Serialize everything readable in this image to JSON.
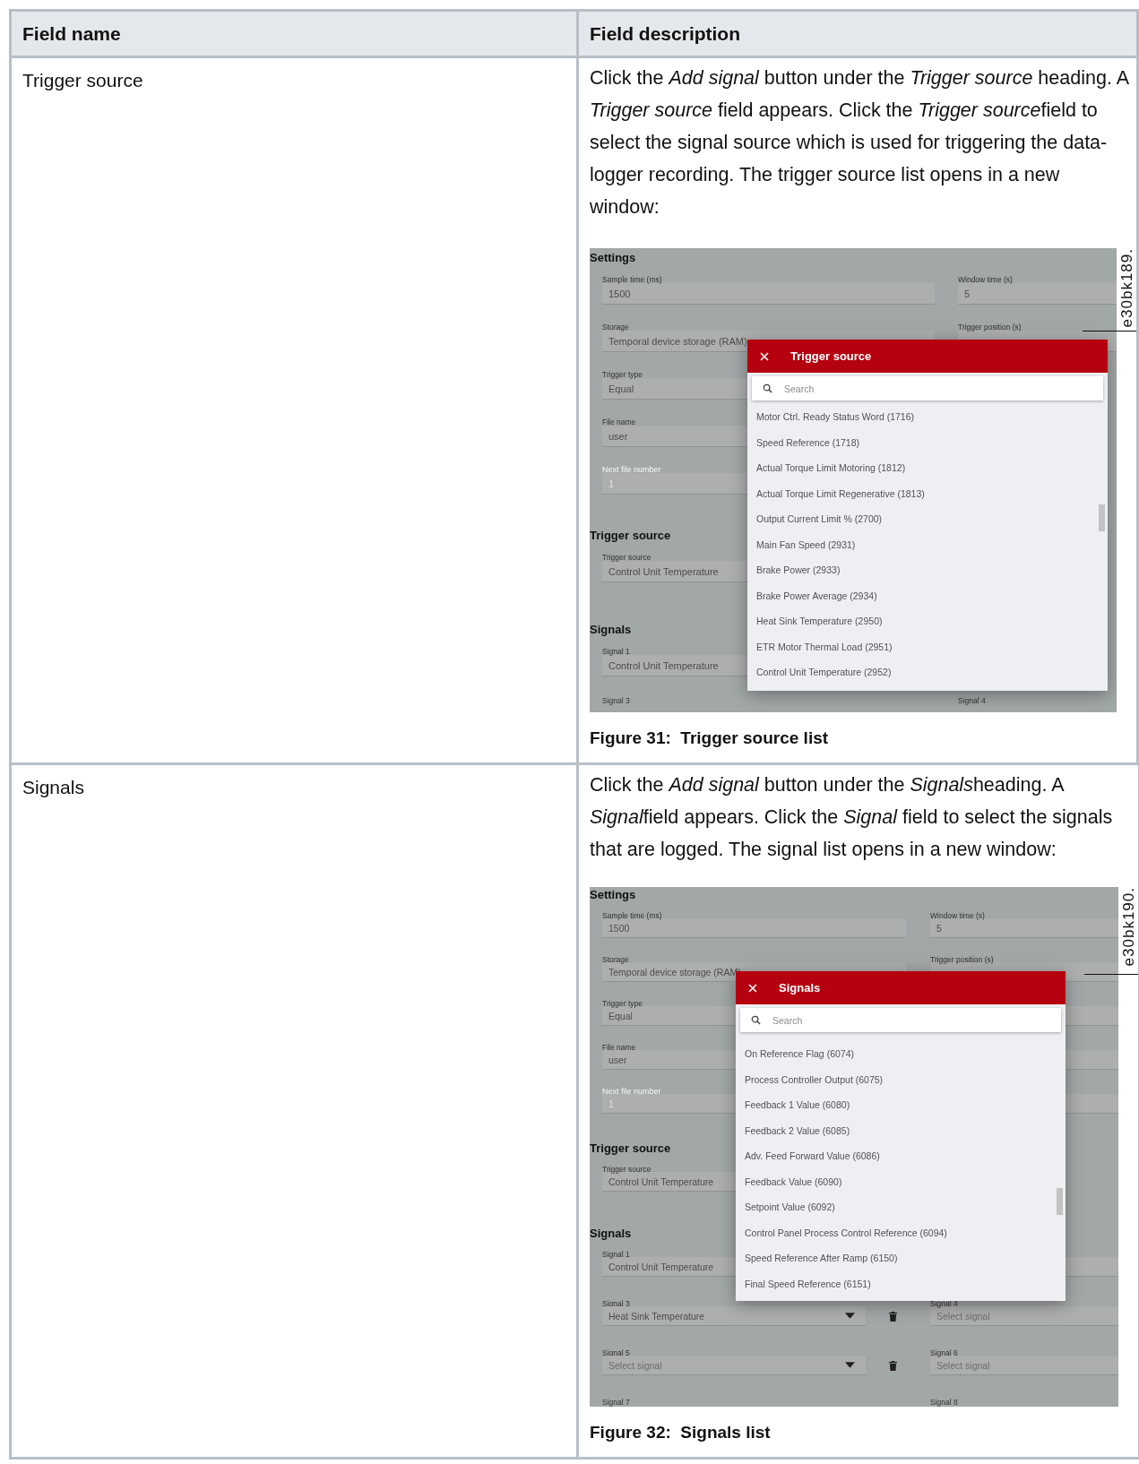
{
  "table": {
    "columns": [
      "Field name",
      "Field description"
    ],
    "rows": [
      {
        "field_name": "Trigger source",
        "description": [
          {
            "text": "Click the ",
            "italic": false
          },
          {
            "text": "Add signal",
            "italic": true
          },
          {
            "text": " button under the ",
            "italic": false
          },
          {
            "text": "Trigger source",
            "italic": true
          },
          {
            "text": " heading. A ",
            "italic": false
          },
          {
            "text": "Trigger source",
            "italic": true
          },
          {
            "text": " field appears. Click the ",
            "italic": false
          },
          {
            "text": "Trigger source",
            "italic": true
          },
          {
            "text": "field to select the signal source which is used for triggering the data-logger recording. The trigger source list opens in a new window:",
            "italic": false
          }
        ],
        "figure": {
          "id_label": "e30bk189.",
          "sections": [
            {
              "heading": "Settings",
              "rows": [
                [
                  {
                    "kind": "field",
                    "label": "Sample time (ms)",
                    "value": "1500",
                    "disabled": false
                  },
                  {
                    "kind": "field",
                    "label": "Window time (s)",
                    "value": "5",
                    "disabled": false
                  }
                ],
                [
                  {
                    "kind": "field",
                    "label": "Storage",
                    "value": "Temporal device storage (RAM)",
                    "disabled": false
                  },
                  {
                    "kind": "field",
                    "label": "Trigger position (s)",
                    "disabled": false
                  }
                ],
                [
                  {
                    "kind": "field",
                    "label": "Trigger type",
                    "value": "Equal",
                    "disabled": false
                  }
                ],
                [
                  {
                    "kind": "field",
                    "label": "File name",
                    "value": "user",
                    "disabled": false
                  }
                ],
                [
                  {
                    "kind": "field",
                    "label": "Next file number",
                    "value": "1",
                    "disabled": true
                  }
                ]
              ]
            },
            {
              "heading": "Trigger source",
              "rows": [
                [
                  {
                    "kind": "field",
                    "label": "Trigger source",
                    "value": "Control Unit Temperature",
                    "disabled": false
                  }
                ]
              ]
            },
            {
              "heading": "Signals",
              "rows": [
                [
                  {
                    "kind": "field",
                    "label": "Signal 1",
                    "value": "Control Unit Temperature",
                    "disabled": false
                  }
                ],
                [
                  {
                    "kind": "label",
                    "label": "Signal 3",
                    "disabled": false
                  },
                  {
                    "kind": "label",
                    "label": "Signal 4",
                    "disabled": false
                  }
                ]
              ]
            }
          ],
          "dialog": {
            "title": "Trigger source",
            "search_placeholder": "Search",
            "items": [
              "Motor Ctrl. Ready Status Word (1716)",
              "Speed Reference (1718)",
              "Actual Torque Limit Motoring (1812)",
              "Actual Torque Limit Regenerative (1813)",
              "Output Current Limit % (2700)",
              "Main Fan Speed (2931)",
              "Brake Power (2933)",
              "Brake Power Average (2934)",
              "Heat Sink Temperature (2950)",
              "ETR Motor Thermal Load (2951)",
              "Control Unit Temperature (2952)"
            ]
          }
        },
        "caption": "Figure 31:  Trigger source list"
      },
      {
        "field_name": "Signals",
        "description": [
          {
            "text": "Click the ",
            "italic": false
          },
          {
            "text": "Add signal",
            "italic": true
          },
          {
            "text": " button under the ",
            "italic": false
          },
          {
            "text": "Signals",
            "italic": true
          },
          {
            "text": "heading. A ",
            "italic": false
          },
          {
            "text": "Signal",
            "italic": true
          },
          {
            "text": "field appears. Click the ",
            "italic": false
          },
          {
            "text": "Signal",
            "italic": true
          },
          {
            "text": " field to select the signals that are logged. The signal list opens in a new window:",
            "italic": false
          }
        ],
        "figure": {
          "id_label": "e30bk190.",
          "sections": [
            {
              "heading": "Settings",
              "rows": [
                [
                  {
                    "kind": "field",
                    "label": "Sample time (ms)",
                    "value": "1500",
                    "disabled": false
                  },
                  {
                    "kind": "field",
                    "label": "Window time (s)",
                    "value": "5",
                    "disabled": false
                  }
                ],
                [
                  {
                    "kind": "field",
                    "label": "Storage",
                    "value": "Temporal device storage (RAM)",
                    "disabled": false
                  },
                  {
                    "kind": "field",
                    "label": "Trigger position (s)",
                    "disabled": false
                  }
                ],
                [
                  {
                    "kind": "field",
                    "label": "Trigger type",
                    "value": "Equal",
                    "disabled": false
                  },
                  {
                    "kind": "field"
                  }
                ],
                [
                  {
                    "kind": "field",
                    "label": "File name",
                    "value": "user",
                    "disabled": false
                  },
                  {
                    "kind": "field"
                  }
                ],
                [
                  {
                    "kind": "field",
                    "label": "Next file number",
                    "value": "1",
                    "disabled": true
                  },
                  {
                    "kind": "field"
                  }
                ]
              ]
            },
            {
              "heading": "Trigger source",
              "rows": [
                [
                  {
                    "kind": "field",
                    "label": "Trigger source",
                    "value": "Control Unit Temperature",
                    "disabled": false
                  }
                ]
              ]
            },
            {
              "heading": "Signals",
              "rows": [
                [
                  {
                    "kind": "field",
                    "label": "Signal 1",
                    "value": "Control Unit Temperature",
                    "disabled": false
                  },
                  {
                    "kind": "field"
                  }
                ],
                [
                  {
                    "kind": "dropdown",
                    "label": "Signal 3",
                    "value": "Heat Sink Temperature",
                    "disabled": false
                  },
                  {
                    "kind": "field",
                    "label": "Signal 4",
                    "placeholder": "Select signal",
                    "disabled": false
                  }
                ],
                [
                  {
                    "kind": "dropdown",
                    "label": "Signal 5",
                    "placeholder": "Select signal",
                    "disabled": false
                  },
                  {
                    "kind": "field",
                    "label": "Signal 6",
                    "placeholder": "Select signal",
                    "disabled": false
                  }
                ],
                [
                  {
                    "kind": "label",
                    "label": "Signal 7",
                    "disabled": false
                  },
                  {
                    "kind": "label",
                    "label": "Signal 8",
                    "disabled": false
                  }
                ]
              ]
            }
          ],
          "dialog": {
            "title": "Signals",
            "search_placeholder": "Search",
            "items": [
              "On Reference Flag (6074)",
              "Process Controller Output (6075)",
              "Feedback 1 Value (6080)",
              "Feedback 2 Value (6085)",
              "Adv. Feed Forward Value (6086)",
              "Feedback Value (6090)",
              "Setpoint Value (6092)",
              "Control Panel Process Control Reference (6094)",
              "Speed Reference After Ramp (6150)",
              "Final Speed Reference (6151)"
            ]
          }
        },
        "caption": "Figure 32:  Signals list"
      }
    ]
  }
}
